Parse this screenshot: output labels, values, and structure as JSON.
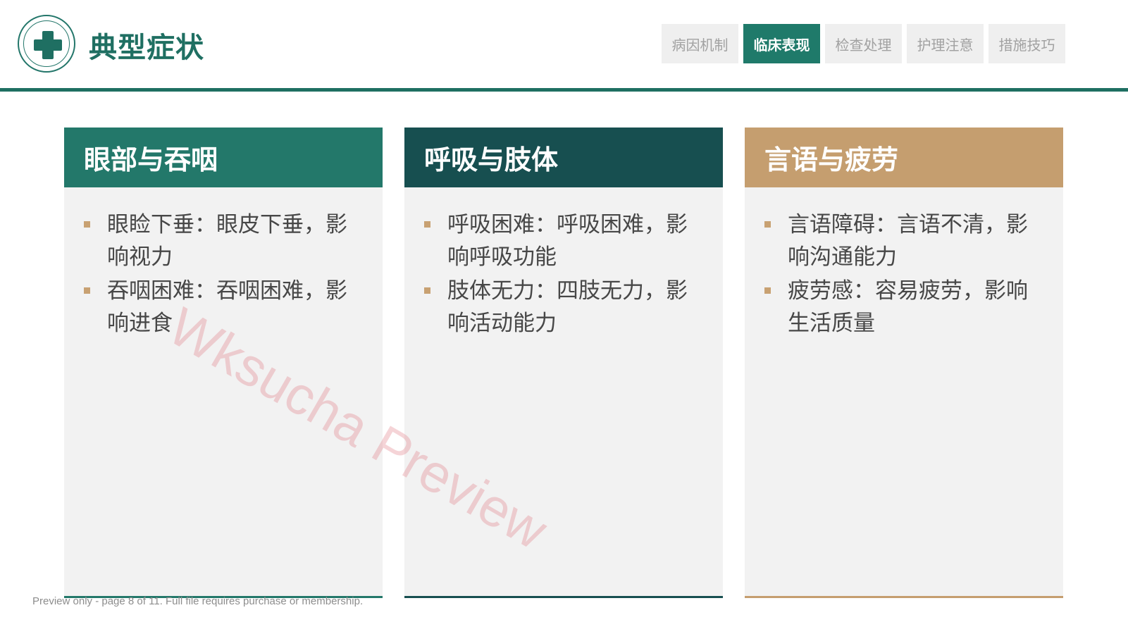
{
  "header": {
    "logo_icon": "medical-cross-icon",
    "title": "典型症状",
    "tabs": [
      {
        "label": "病因机制",
        "active": false
      },
      {
        "label": "临床表现",
        "active": true
      },
      {
        "label": "检查处理",
        "active": false
      },
      {
        "label": "护理注意",
        "active": false
      },
      {
        "label": "措施技巧",
        "active": false
      }
    ]
  },
  "cards": [
    {
      "title": "眼部与吞咽",
      "color": "#23786a",
      "items": [
        "眼睑下垂：眼皮下垂，影响视力",
        "吞咽困难：吞咽困难，影响进食"
      ]
    },
    {
      "title": "呼吸与肢体",
      "color": "#174f50",
      "items": [
        "呼吸困难：呼吸困难，影响呼吸功能",
        "肢体无力：四肢无力，影响活动能力"
      ]
    },
    {
      "title": "言语与疲劳",
      "color": "#c59e6f",
      "items": [
        "言语障碍：言语不清，影响沟通能力",
        "疲劳感：容易疲劳，影响生活质量"
      ]
    }
  ],
  "watermark": "Wksucha Preview",
  "footer_note": "Preview only - page 8 of 11. Full file requires purchase or membership.",
  "colors": {
    "primary": "#1f6f62",
    "accent": "#c59e6f",
    "tab_inactive": "#efefef"
  }
}
